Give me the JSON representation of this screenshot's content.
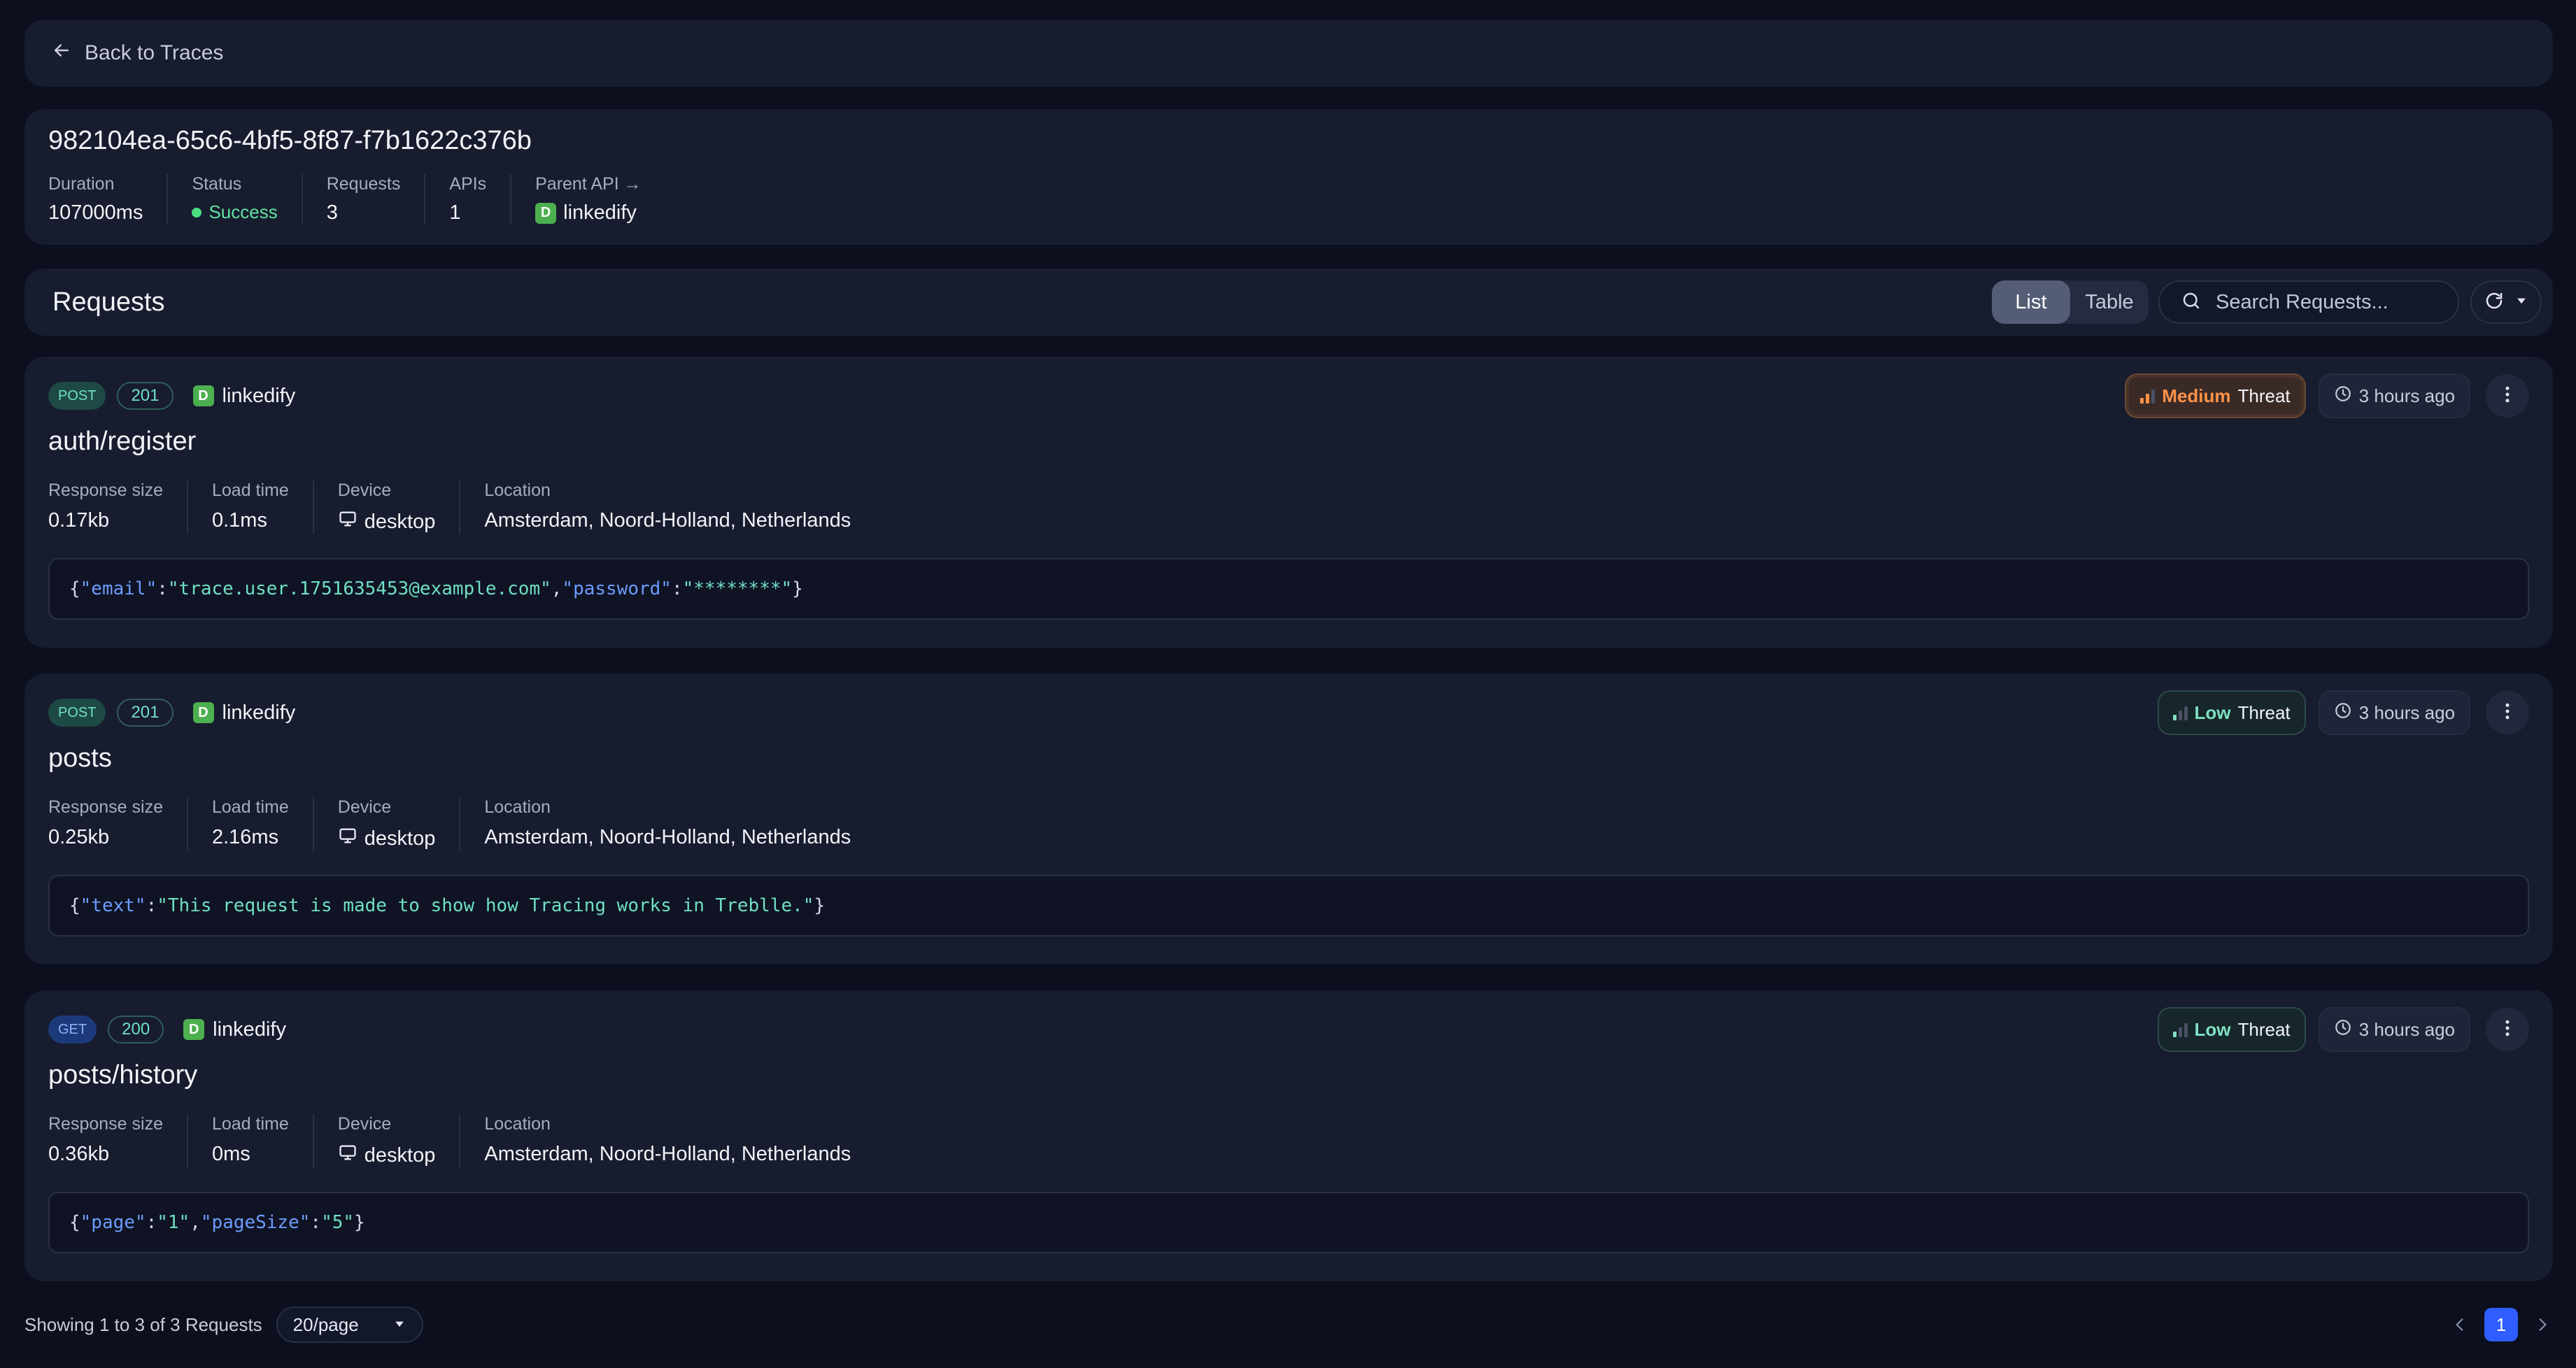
{
  "nav": {
    "back_label": "Back to Traces"
  },
  "trace": {
    "id": "982104ea-65c6-4bf5-8f87-f7b1622c376b",
    "duration_label": "Duration",
    "duration_value": "107000ms",
    "status_label": "Status",
    "status_value": "Success",
    "requests_label": "Requests",
    "requests_value": "3",
    "apis_label": "APIs",
    "apis_value": "1",
    "parent_api_label": "Parent API →",
    "parent_api_badge": "D",
    "parent_api_value": "linkedify"
  },
  "requests_bar": {
    "title": "Requests",
    "view_list": "List",
    "view_table": "Table",
    "search_placeholder": "Search Requests..."
  },
  "labels": {
    "response_size": "Response size",
    "load_time": "Load time",
    "device": "Device",
    "location": "Location",
    "threat_word": "Threat"
  },
  "requests": [
    {
      "method": "POST",
      "status_code": "201",
      "api_badge": "D",
      "api": "linkedify",
      "threat_level": "Medium",
      "time_ago": "3 hours ago",
      "endpoint": "auth/register",
      "response_size": "0.17kb",
      "load_time": "0.1ms",
      "device": "desktop",
      "location": "Amsterdam, Noord-Holland, Netherlands",
      "body": [
        {
          "t": "p",
          "v": "{"
        },
        {
          "t": "k",
          "v": "\"email\""
        },
        {
          "t": "p",
          "v": ":"
        },
        {
          "t": "s",
          "v": "\"trace.user.1751635453@example.com\""
        },
        {
          "t": "p",
          "v": ","
        },
        {
          "t": "k",
          "v": "\"password\""
        },
        {
          "t": "p",
          "v": ":"
        },
        {
          "t": "s",
          "v": "\"********\""
        },
        {
          "t": "p",
          "v": "}"
        }
      ]
    },
    {
      "method": "POST",
      "status_code": "201",
      "api_badge": "D",
      "api": "linkedify",
      "threat_level": "Low",
      "time_ago": "3 hours ago",
      "endpoint": "posts",
      "response_size": "0.25kb",
      "load_time": "2.16ms",
      "device": "desktop",
      "location": "Amsterdam, Noord-Holland, Netherlands",
      "body": [
        {
          "t": "p",
          "v": "{"
        },
        {
          "t": "k",
          "v": "\"text\""
        },
        {
          "t": "p",
          "v": ":"
        },
        {
          "t": "s",
          "v": "\"This request is made to show how Tracing works in Treblle.\""
        },
        {
          "t": "p",
          "v": "}"
        }
      ]
    },
    {
      "method": "GET",
      "status_code": "200",
      "api_badge": "D",
      "api": "linkedify",
      "threat_level": "Low",
      "time_ago": "3 hours ago",
      "endpoint": "posts/history",
      "response_size": "0.36kb",
      "load_time": "0ms",
      "device": "desktop",
      "location": "Amsterdam, Noord-Holland, Netherlands",
      "body": [
        {
          "t": "p",
          "v": "{"
        },
        {
          "t": "k",
          "v": "\"page\""
        },
        {
          "t": "p",
          "v": ":"
        },
        {
          "t": "s",
          "v": "\"1\""
        },
        {
          "t": "p",
          "v": ","
        },
        {
          "t": "k",
          "v": "\"pageSize\""
        },
        {
          "t": "p",
          "v": ":"
        },
        {
          "t": "s",
          "v": "\"5\""
        },
        {
          "t": "p",
          "v": "}"
        }
      ]
    }
  ],
  "footer": {
    "showing": "Showing 1 to 3 of 3 Requests",
    "per_page": "20/page",
    "current_page": "1"
  },
  "colors": {
    "accent": "#2f5dff",
    "success": "#4ade80",
    "medium_threat": "#ff9248",
    "low_threat": "#7ee0c0"
  }
}
